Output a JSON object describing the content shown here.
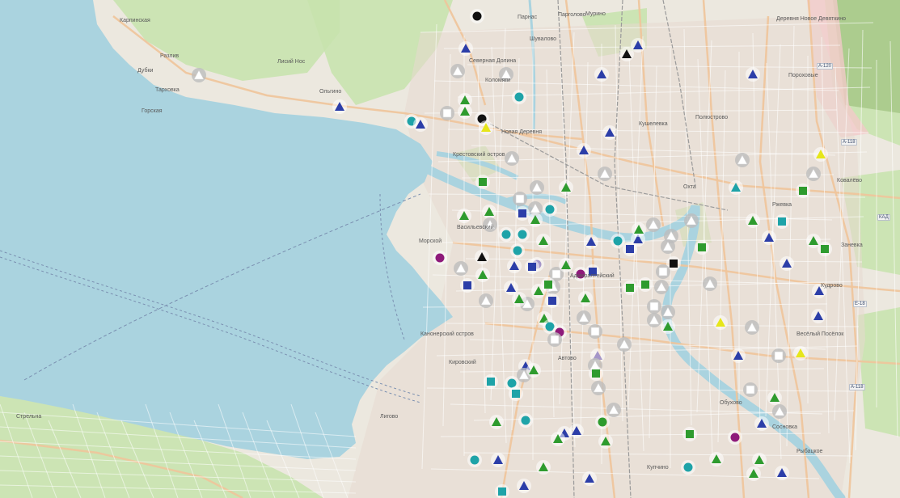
{
  "map": {
    "labels": {
      "karpovka": "Карпинская",
      "razliv": "Разлив",
      "dubki": "Дубки",
      "tarhovka": "Тарховка",
      "gorskaya": "Горская",
      "lisy_nos": "Лисий Нос",
      "olgino": "Ольгино",
      "severnoe": "Северная Долина",
      "kolomyagi": "Коломяги",
      "parnas": "Парнас",
      "kushelevka": "Кушелевка",
      "okhta": "Охта",
      "polyustrovo": "Полюстрово",
      "rzhevka": "Ржевка",
      "kovalevo": "Ковалёво",
      "porokhovye": "Пороховые",
      "novoe_derevnya": "Новая Деревня",
      "krestovsky": "Крестовский остров",
      "morskoy": "Морской",
      "vasileostrovsky": "Васильевский",
      "admiralteysky": "Адмиралтейский",
      "kirovsky": "Кировский",
      "kupchino": "Купчино",
      "sosnovka": "Сосновка",
      "rybatskoe": "Рыбацкое",
      "strelna": "Стрельна",
      "avtovo": "Автово",
      "ligovo": "Лигово",
      "kanonersky": "Канонерский остров",
      "obukhovo": "Обухово",
      "vesyoly": "Весёлый Посёлок",
      "kudrovo": "Кудрово",
      "zanevka": "Заневка",
      "murino": "Мурино",
      "devyatkino": "Деревня Новое Девяткино",
      "shuvalovo": "Шувалово",
      "pargolovo": "Парголово",
      "a118": "А-118",
      "a120": "А-120",
      "kad": "КАД",
      "e18": "Е-18"
    },
    "marker_colors": {
      "blue": "#2c3ea8",
      "green": "#2e9b2e",
      "teal": "#1ea3a8",
      "white": "#ffffff",
      "black": "#111111",
      "yellow": "#e6e61a",
      "purple": "#8e1a7a",
      "lavender": "#a596c8"
    },
    "marker_legend": {
      "shapes": [
        "triangle",
        "square",
        "circle"
      ],
      "colors": [
        "blue",
        "green",
        "teal",
        "white",
        "black",
        "yellow",
        "purple",
        "lavender"
      ]
    }
  }
}
